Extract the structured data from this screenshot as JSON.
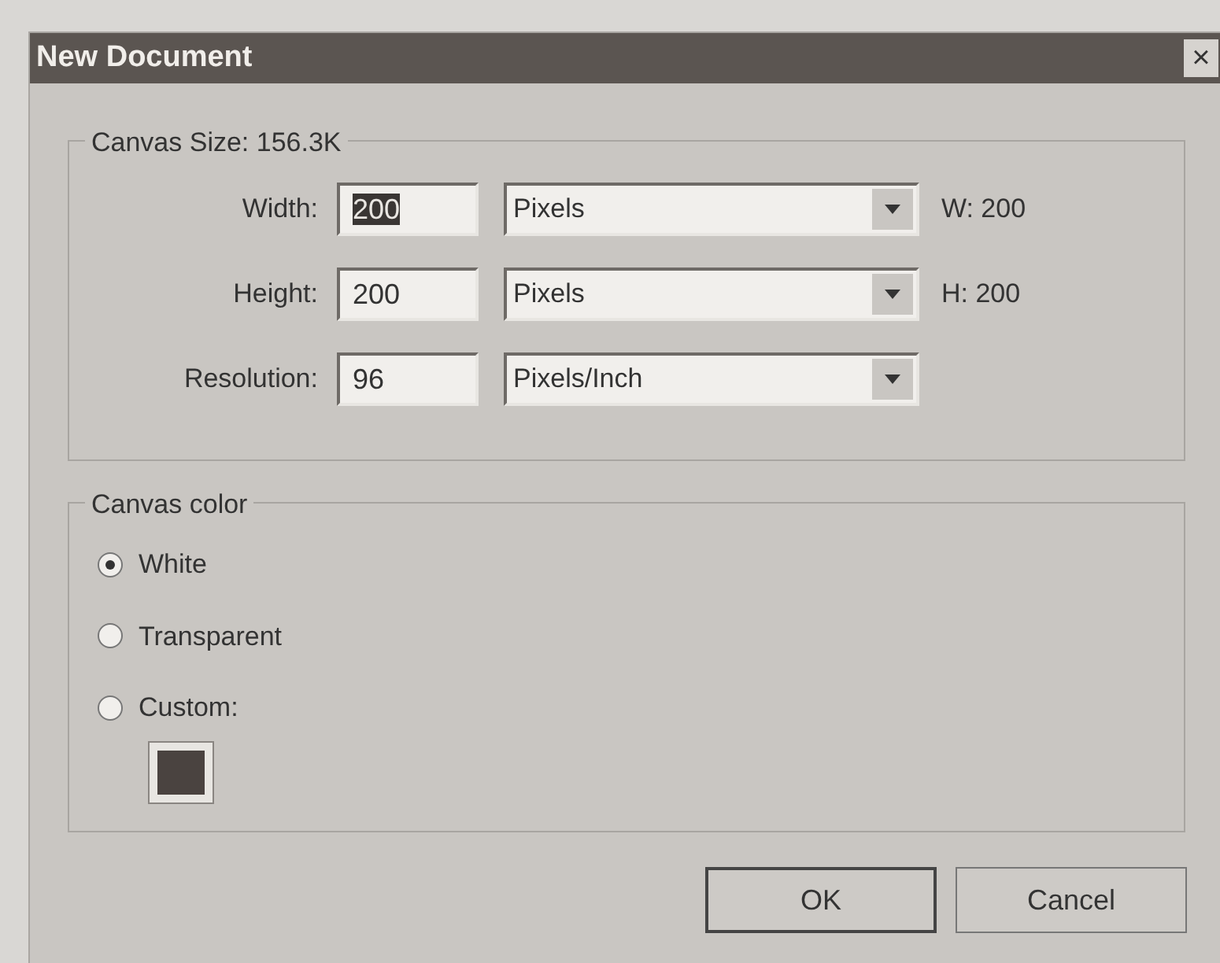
{
  "window": {
    "title": "New Document",
    "close": "×"
  },
  "canvas_size": {
    "legend": "Canvas Size: 156.3K",
    "rows": [
      {
        "label": "Width:",
        "value": "200",
        "text_selected": true,
        "unit": "Pixels",
        "readout": "W: 200"
      },
      {
        "label": "Height:",
        "value": "200",
        "text_selected": false,
        "unit": "Pixels",
        "readout": "H: 200"
      },
      {
        "label": "Resolution:",
        "value": "96",
        "text_selected": false,
        "unit": "Pixels/Inch"
      }
    ]
  },
  "canvas_color": {
    "legend": "Canvas color",
    "options": [
      {
        "label": "White",
        "selected": true
      },
      {
        "label": "Transparent",
        "selected": false
      },
      {
        "label": "Custom:",
        "selected": false
      }
    ],
    "swatch": {
      "color": "#4a4340"
    }
  },
  "buttons": [
    {
      "label": "OK",
      "kind": "default"
    },
    {
      "label": "Cancel",
      "kind": "normal"
    }
  ]
}
